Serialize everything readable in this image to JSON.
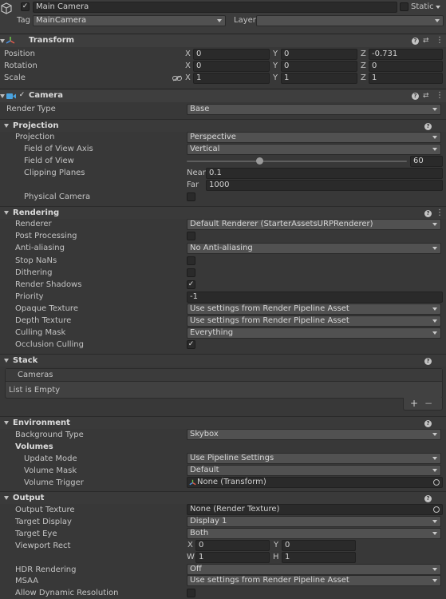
{
  "header": {
    "object_name": "Main Camera",
    "static_label": "Static",
    "tag_label": "Tag",
    "tag_value": "MainCamera",
    "layer_label": "Layer",
    "layer_value": ""
  },
  "transform": {
    "title": "Transform",
    "position_label": "Position",
    "rotation_label": "Rotation",
    "scale_label": "Scale",
    "axis_x": "X",
    "axis_y": "Y",
    "axis_z": "Z",
    "position": [
      "0",
      "0",
      "-0.731"
    ],
    "rotation": [
      "0",
      "0",
      "0"
    ],
    "scale": [
      "1",
      "1",
      "1"
    ]
  },
  "camera": {
    "title": "Camera",
    "render_type_label": "Render Type",
    "render_type": "Base",
    "projection": {
      "title": "Projection",
      "projection_label": "Projection",
      "projection_value": "Perspective",
      "fov_axis_label": "Field of View Axis",
      "fov_axis_value": "Vertical",
      "fov_label": "Field of View",
      "fov_value": "60",
      "fov_fraction": 0.33,
      "clipping_label": "Clipping Planes",
      "near_label": "Near",
      "near_value": "0.1",
      "far_label": "Far",
      "far_value": "1000",
      "physical_label": "Physical Camera"
    },
    "rendering": {
      "title": "Rendering",
      "renderer_label": "Renderer",
      "renderer_value": "Default Renderer (StarterAssetsURPRenderer)",
      "post_label": "Post Processing",
      "aa_label": "Anti-aliasing",
      "aa_value": "No Anti-aliasing",
      "nans_label": "Stop NaNs",
      "dither_label": "Dithering",
      "shadows_label": "Render Shadows",
      "priority_label": "Priority",
      "priority_value": "-1",
      "opaque_label": "Opaque Texture",
      "opaque_value": "Use settings from Render Pipeline Asset",
      "depth_label": "Depth Texture",
      "depth_value": "Use settings from Render Pipeline Asset",
      "culling_label": "Culling Mask",
      "culling_value": "Everything",
      "occlusion_label": "Occlusion Culling"
    },
    "stack": {
      "title": "Stack",
      "cameras_label": "Cameras",
      "empty_text": "List is Empty",
      "add_label": "+",
      "remove_label": "−"
    },
    "environment": {
      "title": "Environment",
      "bg_type_label": "Background Type",
      "bg_type_value": "Skybox",
      "volumes_label": "Volumes",
      "update_label": "Update Mode",
      "update_value": "Use Pipeline Settings",
      "mask_label": "Volume Mask",
      "mask_value": "Default",
      "trigger_label": "Volume Trigger",
      "trigger_value": "None (Transform)"
    },
    "output": {
      "title": "Output",
      "texture_label": "Output Texture",
      "texture_value": "None (Render Texture)",
      "display_label": "Target Display",
      "display_value": "Display 1",
      "eye_label": "Target Eye",
      "eye_value": "Both",
      "viewport_label": "Viewport Rect",
      "vp_x_label": "X",
      "vp_x": "0",
      "vp_y_label": "Y",
      "vp_y": "0",
      "vp_w_label": "W",
      "vp_w": "1",
      "vp_h_label": "H",
      "vp_h": "1",
      "hdr_label": "HDR Rendering",
      "hdr_value": "Off",
      "msaa_label": "MSAA",
      "msaa_value": "Use settings from Render Pipeline Asset",
      "dynres_label": "Allow Dynamic Resolution"
    }
  },
  "colors": {
    "panel": "#383838",
    "field": "#2a2a2a",
    "dropdown": "#515151",
    "header": "#3e3e3e",
    "accent_blue": "#4aa3df"
  }
}
